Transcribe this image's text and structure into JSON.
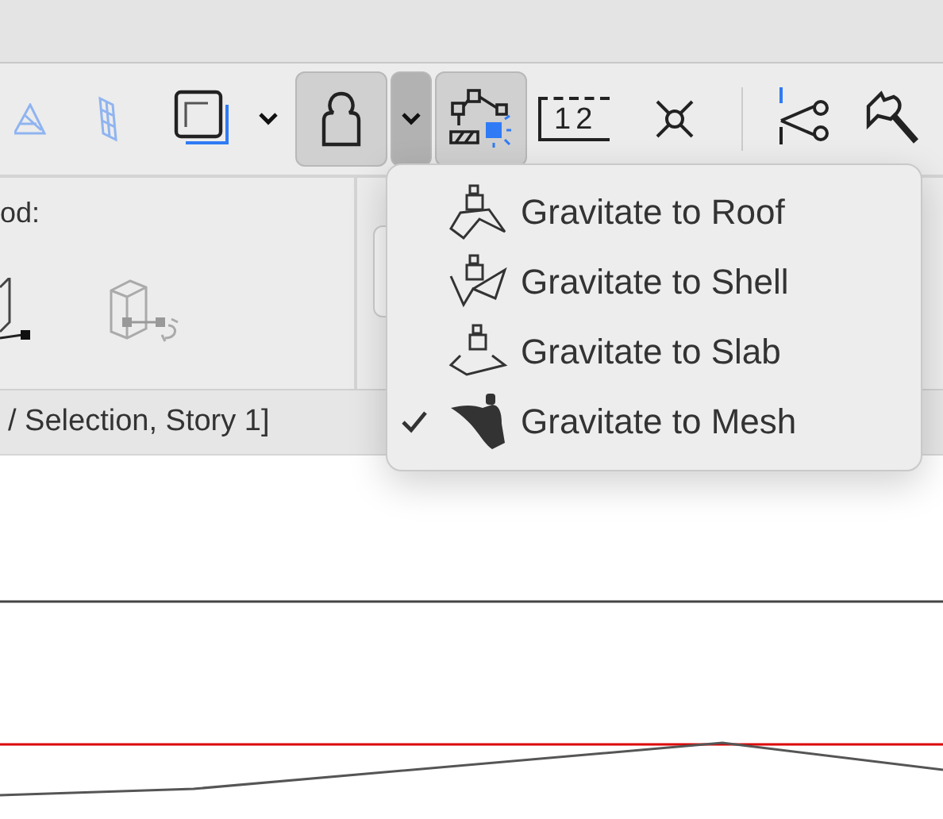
{
  "toolbar": {
    "tools": [
      {
        "kind": "plane",
        "pressed": false
      },
      {
        "kind": "grid",
        "pressed": false
      },
      {
        "kind": "layers",
        "pressed": false
      },
      {
        "kind": "caret",
        "pressed": false
      },
      {
        "kind": "gravity",
        "pressed": true
      },
      {
        "kind": "caret",
        "pressed": true
      },
      {
        "kind": "snap",
        "pressed": true
      },
      {
        "kind": "ruler",
        "pressed": false,
        "label": "12"
      },
      {
        "kind": "cross",
        "pressed": false
      },
      {
        "kind": "divider"
      },
      {
        "kind": "scissors",
        "pressed": false
      },
      {
        "kind": "axe",
        "pressed": false
      }
    ]
  },
  "panel": {
    "left_label": "od:"
  },
  "status_bar": {
    "text": "/ Selection, Story 1]"
  },
  "menu": {
    "items": [
      {
        "label": "Gravitate to Roof",
        "kind": "roof",
        "checked": false
      },
      {
        "label": "Gravitate to Shell",
        "kind": "shell",
        "checked": false
      },
      {
        "label": "Gravitate to Slab",
        "kind": "slab",
        "checked": false
      },
      {
        "label": "Gravitate to Mesh",
        "kind": "mesh",
        "checked": true
      }
    ]
  }
}
